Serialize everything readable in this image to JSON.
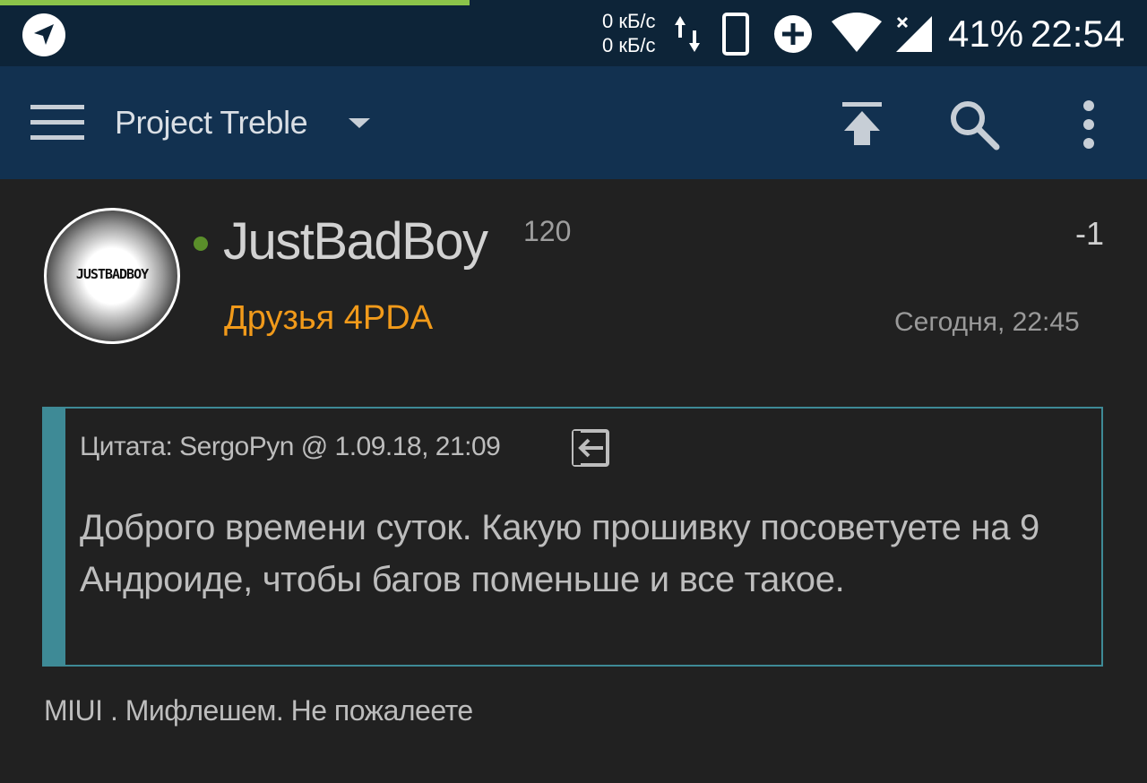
{
  "status_bar": {
    "net_up": "0 кБ/с",
    "net_down": "0 кБ/с",
    "battery": "41%",
    "time": "22:54",
    "icons": [
      "navigation-icon",
      "data-updown-icon",
      "phone-icon",
      "data-saver-icon",
      "wifi-icon",
      "signal-icon"
    ]
  },
  "toolbar": {
    "title": "Project Treble",
    "icons": [
      "menu-icon",
      "dropdown-icon",
      "scroll-top-icon",
      "search-icon",
      "more-icon"
    ]
  },
  "post": {
    "avatar_text": "JUSTBADBOY",
    "username": "JustBadBoy",
    "reputation": "120",
    "rating": "-1",
    "group": "Друзья 4PDA",
    "date": "Сегодня, 22:45",
    "quote": {
      "header": "Цитата: SergoPyn @ 1.09.18, 21:09",
      "text": "Доброго времени суток. Какую прошивку посоветуете на 9 Андроиде, чтобы багов поменьше и все такое."
    },
    "body": "MIUI . Мифлешем. Не пожалеете"
  },
  "colors": {
    "status_bar": "#0d2438",
    "toolbar": "#123150",
    "background": "#212121",
    "online": "#5a8e2a",
    "group": "#f19a1a",
    "quote_accent": "#3e8a96",
    "progress": "#8bc34a"
  }
}
